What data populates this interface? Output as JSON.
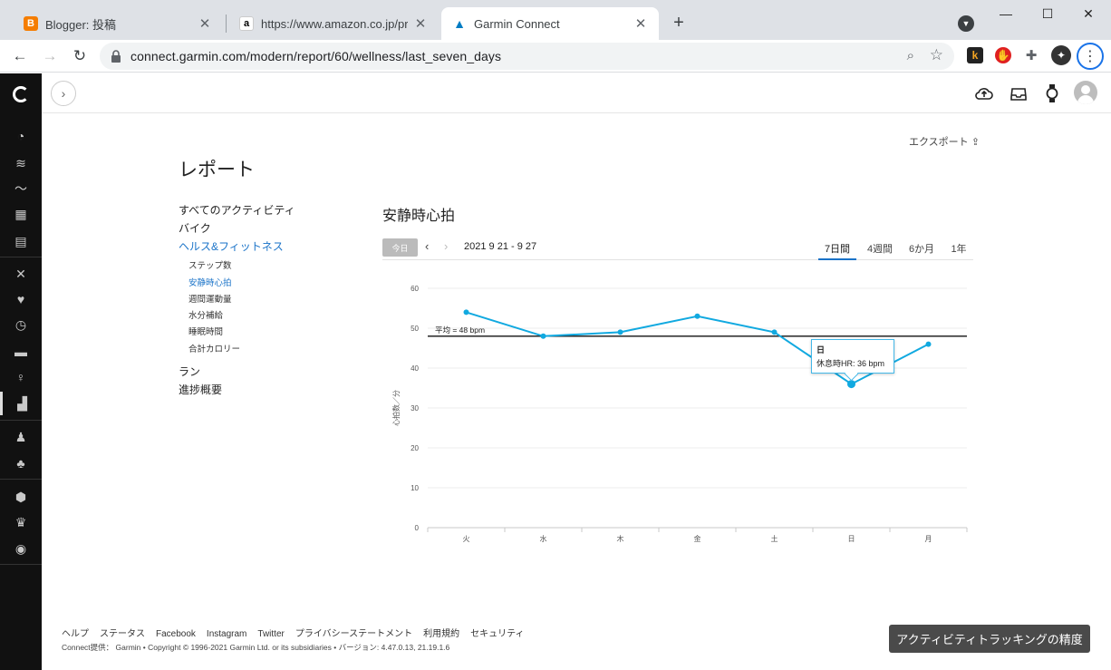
{
  "browser": {
    "tabs": [
      {
        "title": "Blogger: 投稿",
        "favicon": "B"
      },
      {
        "title": "https://www.amazon.co.jp/progre",
        "favicon": "a"
      },
      {
        "title": "Garmin Connect",
        "favicon": "▲"
      }
    ],
    "url": "connect.garmin.com/modern/report/60/wellness/last_seven_days",
    "extensions": [
      "k",
      "✋",
      "✦"
    ]
  },
  "report": {
    "page_title": "レポート",
    "export_label": "エクスポート",
    "nav": {
      "all_activities": "すべてのアクティビティ",
      "bike": "バイク",
      "health_fitness": "ヘルス&フィットネス",
      "sub": [
        "ステップ数",
        "安静時心拍",
        "週間運動量",
        "水分補給",
        "睡眠時間",
        "合計カロリー"
      ],
      "run": "ラン",
      "progress": "進捗概要"
    },
    "chart_title": "安静時心拍",
    "today_btn": "今日",
    "date_range": "2021 9 21 - 9 27",
    "range_tabs": [
      "7日間",
      "4週間",
      "6か月",
      "1年"
    ],
    "tooltip": {
      "day": "日",
      "text": "休息時HR: 36 bpm"
    }
  },
  "chart_data": {
    "type": "line",
    "categories": [
      "火",
      "水",
      "木",
      "金",
      "土",
      "日",
      "月"
    ],
    "values": [
      54,
      48,
      49,
      53,
      49,
      36,
      46
    ],
    "ylabel": "心拍数／分",
    "ylim": [
      0,
      60
    ],
    "yticks": [
      0,
      10,
      20,
      30,
      40,
      50,
      60
    ],
    "average": {
      "value": 48,
      "label": "平均 = 48 bpm"
    },
    "grid": true,
    "highlight_index": 5,
    "series_color": "#11a9e0"
  },
  "footer": {
    "links": [
      "ヘルプ",
      "ステータス",
      "Facebook",
      "Instagram",
      "Twitter",
      "プライバシーステートメント",
      "利用規約",
      "セキュリティ"
    ],
    "copyright": "Connect提供： Garmin • Copyright © 1996-2021 Garmin Ltd. or its subsidiaries • バージョン: 4.47.0.13, 21.19.1.6",
    "accuracy_button": "アクティビティトラッキングの精度"
  },
  "colors": {
    "accent": "#1a73c8",
    "line": "#11a9e0",
    "sidenav": "#111111"
  }
}
